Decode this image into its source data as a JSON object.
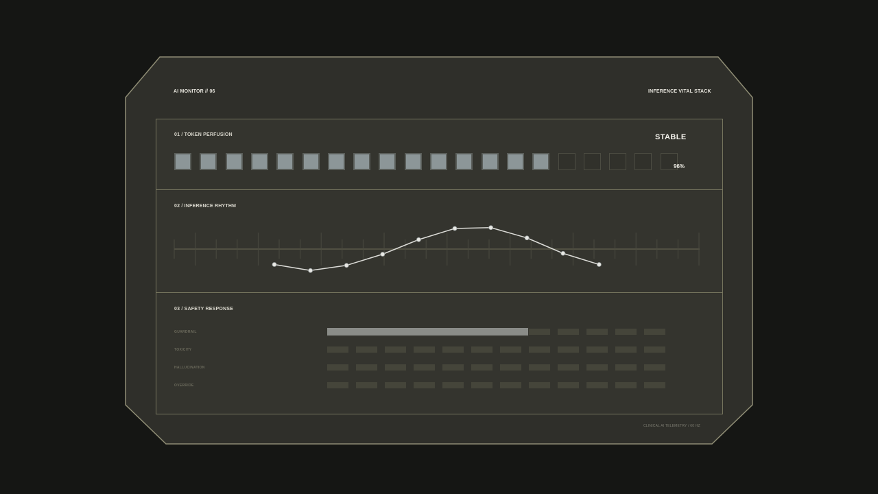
{
  "header": {
    "left_label": "AI MONITOR // 06",
    "right_label": "INFERENCE VITAL STACK"
  },
  "token_perfusion": {
    "title": "01 / TOKEN PERFUSION",
    "status": "STABLE",
    "percent_label": "96%",
    "cells_total": 20,
    "cells_filled": 15
  },
  "inference_rhythm": {
    "title": "02 / INFERENCE RHYTHM",
    "chart_data": {
      "type": "line",
      "x": [
        1,
        2,
        3,
        4,
        5,
        6,
        7,
        8,
        9,
        10
      ],
      "values": [
        -0.9,
        -1.25,
        -0.95,
        -0.3,
        0.55,
        1.2,
        1.25,
        0.65,
        -0.25,
        -0.9
      ],
      "ylim": [
        -2,
        2
      ],
      "grid": false
    }
  },
  "safety_response": {
    "title": "03 / SAFETY RESPONSE",
    "rows": [
      {
        "label": "GUARDRAIL",
        "level": 0.595
      },
      {
        "label": "TOXICITY",
        "level": 0
      },
      {
        "label": "HALLUCINATION",
        "level": 0
      },
      {
        "label": "OVERRIDE",
        "level": 0
      }
    ],
    "segments": 12
  },
  "footer": {
    "label": "CLINICAL AI TELEMETRY / 60 HZ"
  },
  "colors": {
    "background": "#151614",
    "frame_fill": "#2f2f2a",
    "frame_border": "#8e8c74",
    "panel_border": "#77765f",
    "cell_on": "#8c9698",
    "line": "#dcdcd8"
  }
}
